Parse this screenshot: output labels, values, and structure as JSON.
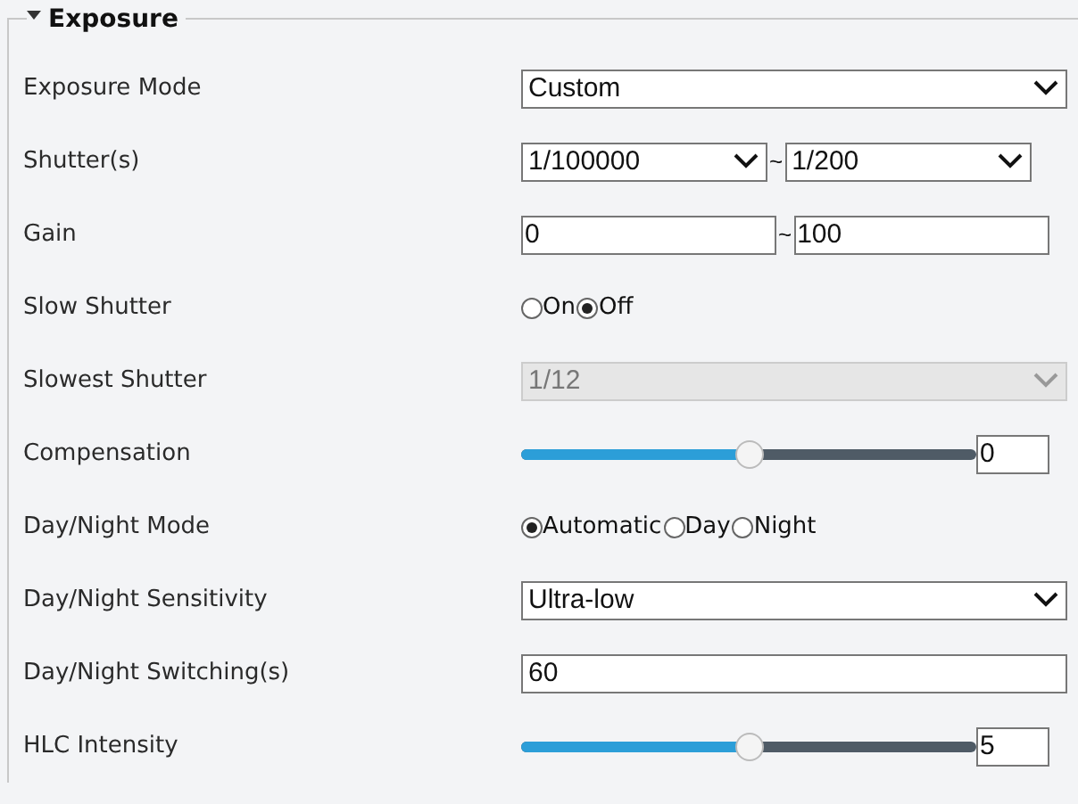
{
  "section": {
    "title": "Exposure",
    "expanded": true
  },
  "rows": [
    {
      "kind": "select",
      "label": "Exposure Mode",
      "value": "Custom",
      "disabled": false
    },
    {
      "kind": "select_range",
      "label": "Shutter(s)",
      "from": "1/100000",
      "separator": "~",
      "to": "1/200"
    },
    {
      "kind": "input_range",
      "label": "Gain",
      "from": "0",
      "separator": "~",
      "to": "100"
    },
    {
      "kind": "radio",
      "label": "Slow Shutter",
      "options": [
        {
          "label": "On",
          "selected": false
        },
        {
          "label": "Off",
          "selected": true
        }
      ]
    },
    {
      "kind": "select",
      "label": "Slowest Shutter",
      "value": "1/12",
      "disabled": true
    },
    {
      "kind": "slider",
      "label": "Compensation",
      "level": 0.5,
      "value": "0"
    },
    {
      "kind": "radio",
      "label": "Day/Night Mode",
      "options": [
        {
          "label": "Automatic",
          "selected": true
        },
        {
          "label": "Day",
          "selected": false
        },
        {
          "label": "Night",
          "selected": false
        }
      ]
    },
    {
      "kind": "select",
      "label": "Day/Night Sensitivity",
      "value": "Ultra-low",
      "disabled": false
    },
    {
      "kind": "input",
      "label": "Day/Night Switching(s)",
      "value": "60"
    },
    {
      "kind": "slider",
      "label": "HLC Intensity",
      "level": 0.5,
      "value": "5"
    }
  ]
}
